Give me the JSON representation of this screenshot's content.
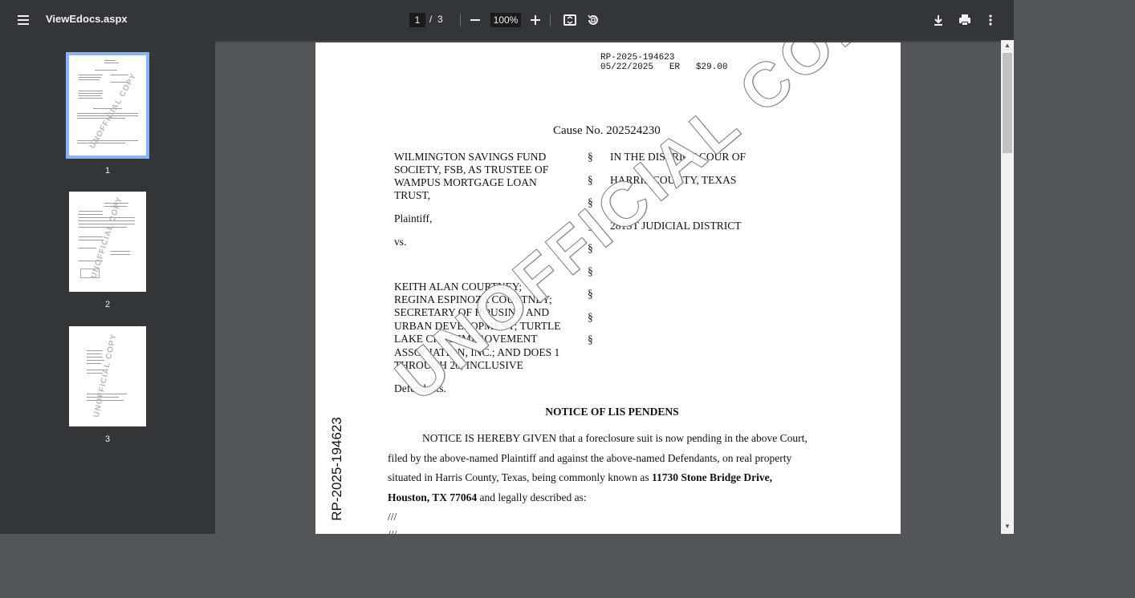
{
  "toolbar": {
    "title": "ViewEdocs.aspx",
    "current_page": "1",
    "page_separator": "/",
    "total_pages": "3",
    "zoom": "100%"
  },
  "sidebar": {
    "thumbnails": [
      {
        "number": "1",
        "active": true,
        "watermark": "UNOFFICIAL COPY"
      },
      {
        "number": "2",
        "active": false,
        "watermark": "UNOFFICIAL COPY"
      },
      {
        "number": "3",
        "active": false,
        "watermark": "UNOFFICIAL COPY"
      }
    ]
  },
  "document": {
    "recording_number": "RP-2025-194623",
    "recording_line": "05/22/2025   ER   $29.00",
    "cause_number": "Cause No. 202524230",
    "plaintiff_lines": [
      "WILMINGTON SAVINGS FUND",
      "SOCIETY, FSB, AS TRUSTEE OF",
      "WAMPUS MORTGAGE LOAN",
      "TRUST,"
    ],
    "plaintiff_label": "Plaintiff,",
    "vs_label": "vs.",
    "defendant_lines": [
      "KEITH ALAN COURTNEY;",
      "REGINA ESPINOZA COURTNEY;",
      "SECRETARY OF HOUSING AND",
      "URBAN DEVELOPMENT; TURTLE",
      "LAKE CIVIC IMPROVEMENT",
      "ASSOCIATION, INC.; AND DOES 1",
      "THROUGH 20, INCLUSIVE"
    ],
    "defendants_label": "Defendants.",
    "section_symbol": "§",
    "court_line_1": "IN THE DISTRICT COUR OF",
    "court_line_2": "HARRIS COUNTY, TEXAS",
    "court_line_3": "281ST JUDICIAL DISTRICT",
    "notice_heading": "NOTICE OF LIS PENDENS",
    "body_line_1": "NOTICE IS HEREBY GIVEN that a foreclosure suit is now pending in the above Court,",
    "body_line_2": "filed by the above-named Plaintiff and against the above-named Defendants, on real property",
    "body_line_3_start": "situated in Harris County, Texas, being commonly known as ",
    "body_line_3_bold": "11730 Stone Bridge Drive,",
    "body_line_4_bold": "Houston, TX 77064",
    "body_line_4_end": " and legally described as:",
    "body_line_5": "///",
    "body_line_6": "///",
    "side_number": "RP-2025-194623",
    "watermark": "UNOFFICIAL COPY"
  }
}
